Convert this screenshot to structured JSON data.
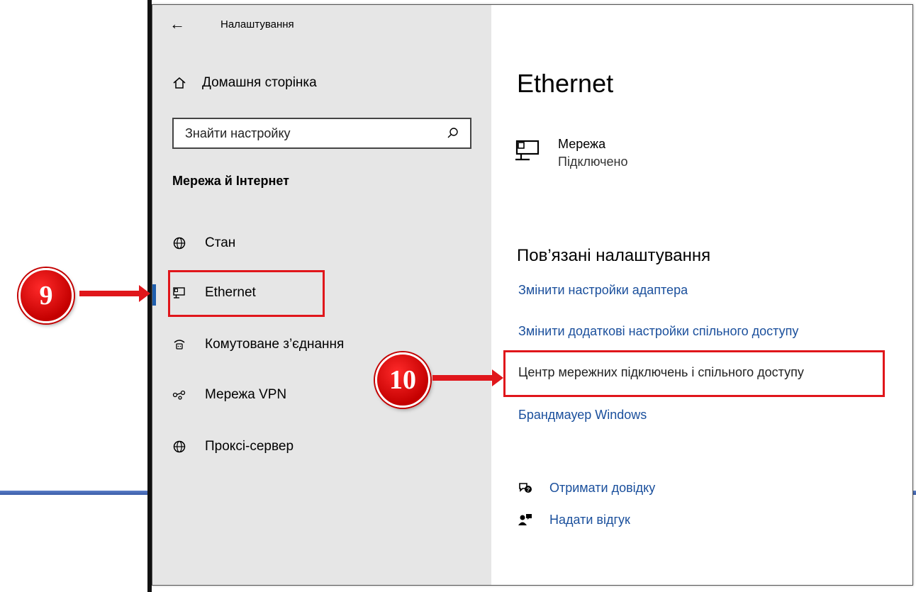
{
  "window": {
    "title": "Налаштування"
  },
  "sidebar": {
    "home_label": "Домашня сторінка",
    "search_placeholder": "Знайти настройку",
    "section_title": "Мережа й Інтернет",
    "items": [
      {
        "label": "Стан",
        "icon": "globe-status-icon"
      },
      {
        "label": "Ethernet",
        "icon": "ethernet-icon"
      },
      {
        "label": "Комутоване з’єднання",
        "icon": "dialup-icon"
      },
      {
        "label": "Мережа VPN",
        "icon": "vpn-icon"
      },
      {
        "label": "Проксі-сервер",
        "icon": "globe-icon"
      }
    ]
  },
  "main": {
    "title": "Ethernet",
    "network": {
      "name": "Мережа",
      "status": "Підключено"
    },
    "related_title": "Пов’язані налаштування",
    "links": [
      "Змінити настройки адаптера",
      "Змінити додаткові настройки спільного доступу",
      "Центр мережних підключень і спільного доступу",
      "Брандмауер Windows"
    ],
    "help": [
      {
        "label": "Отримати довідку",
        "icon": "help-chat-icon"
      },
      {
        "label": "Надати відгук",
        "icon": "feedback-icon"
      }
    ]
  },
  "annotations": {
    "step1": "9",
    "step2": "10"
  },
  "colors": {
    "accent": "#1f5fae",
    "link": "#1a4f9c",
    "annotation_red": "#e0161b"
  }
}
